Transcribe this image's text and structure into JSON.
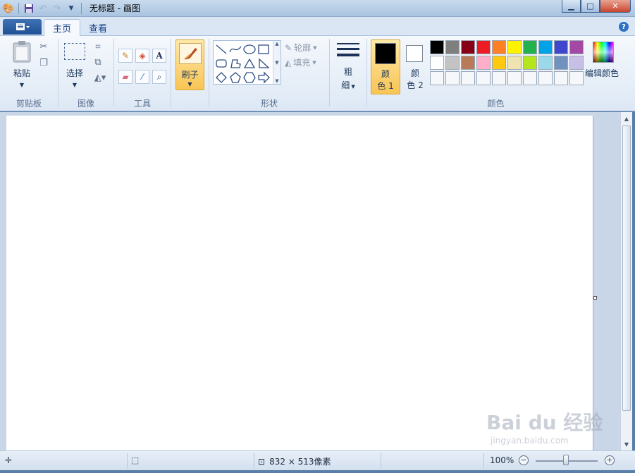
{
  "window": {
    "title": "无标题 - 画图"
  },
  "tabs": {
    "home": "主页",
    "view": "查看"
  },
  "clipboard": {
    "paste_label": "粘贴",
    "group_label": "剪贴板"
  },
  "image": {
    "select_label": "选择",
    "group_label": "图像"
  },
  "tools": {
    "group_label": "工具"
  },
  "brushes": {
    "label": "刷子"
  },
  "shapes": {
    "outline_label": "轮廓",
    "fill_label": "填充",
    "group_label": "形状"
  },
  "size": {
    "label_line1": "粗",
    "label_line2": "细"
  },
  "colors": {
    "color1_line1": "颜",
    "color1_line2": "色 1",
    "color2_line1": "颜",
    "color2_line2": "色 2",
    "edit_label": "编辑颜色",
    "group_label": "颜色",
    "color1_value": "#000000",
    "color2_value": "#ffffff",
    "palette_row1": [
      "#000000",
      "#7f7f7f",
      "#880015",
      "#ed1c24",
      "#ff7f27",
      "#fff200",
      "#22b14c",
      "#00a2e8",
      "#3f48cc",
      "#a349a4"
    ],
    "palette_row2": [
      "#ffffff",
      "#c3c3c3",
      "#b97a57",
      "#ffaec9",
      "#ffc90e",
      "#efe4b0",
      "#b5e61d",
      "#99d9ea",
      "#7092be",
      "#c8bfe7"
    ],
    "palette_row3": [
      "#f5f7fa",
      "#f5f7fa",
      "#f5f7fa",
      "#f5f7fa",
      "#f5f7fa",
      "#f5f7fa",
      "#f5f7fa",
      "#f5f7fa",
      "#f5f7fa",
      "#f5f7fa"
    ]
  },
  "status": {
    "image_size": "832 × 513像素",
    "zoom": "100%"
  },
  "watermark": {
    "brand": "Bai du 经验",
    "url": "jingyan.baidu.com"
  }
}
